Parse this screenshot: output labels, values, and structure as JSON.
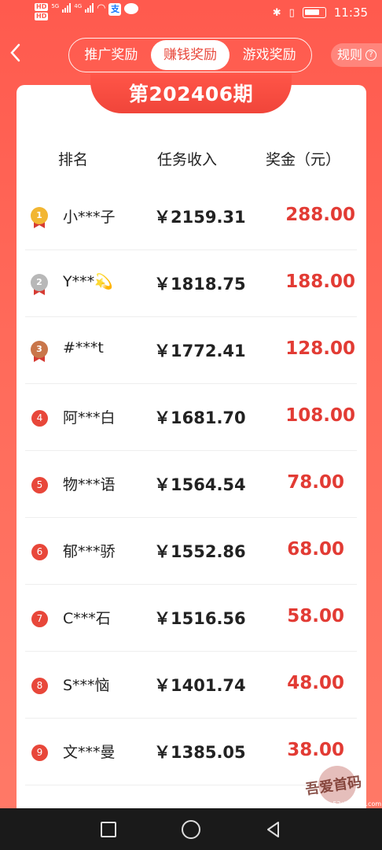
{
  "status_bar": {
    "time": "11:35",
    "hd_label": "HD",
    "signal_label_1": "5G",
    "signal_label_2": "4G",
    "app_icon_char": "支"
  },
  "header": {
    "tabs": [
      {
        "label": "推广奖励",
        "active": false
      },
      {
        "label": "赚钱奖励",
        "active": true
      },
      {
        "label": "游戏奖励",
        "active": false
      }
    ],
    "rules_label": "规则",
    "rules_icon": "?"
  },
  "period": {
    "title": "第202406期"
  },
  "table": {
    "columns": [
      "排名",
      "任务收入",
      "奖金（元）"
    ],
    "rows": [
      {
        "rank": "1",
        "name": "小***子",
        "income": "￥2159.31",
        "prize": "288.00",
        "medal": "gold"
      },
      {
        "rank": "2",
        "name": "Y***💫",
        "income": "￥1818.75",
        "prize": "188.00",
        "medal": "silver"
      },
      {
        "rank": "3",
        "name": "#***t",
        "income": "￥1772.41",
        "prize": "128.00",
        "medal": "bronze"
      },
      {
        "rank": "4",
        "name": "阿***白",
        "income": "￥1681.70",
        "prize": "108.00",
        "medal": "none"
      },
      {
        "rank": "5",
        "name": "物***语",
        "income": "￥1564.54",
        "prize": "78.00",
        "medal": "none"
      },
      {
        "rank": "6",
        "name": "郁***骄",
        "income": "￥1552.86",
        "prize": "68.00",
        "medal": "none"
      },
      {
        "rank": "7",
        "name": "C***石",
        "income": "￥1516.56",
        "prize": "58.00",
        "medal": "none"
      },
      {
        "rank": "8",
        "name": "S***恼",
        "income": "￥1401.74",
        "prize": "48.00",
        "medal": "none"
      },
      {
        "rank": "9",
        "name": "文***曼",
        "income": "￥1385.05",
        "prize": "38.00",
        "medal": "none"
      }
    ]
  },
  "watermark": {
    "text": "吾爱首码",
    "url": "www.52shouma.com"
  },
  "colors": {
    "accent": "#e23b34",
    "background": "#ff5a4e",
    "gold": "#f2b632",
    "silver": "#b8b8b8",
    "bronze": "#c9764a"
  }
}
